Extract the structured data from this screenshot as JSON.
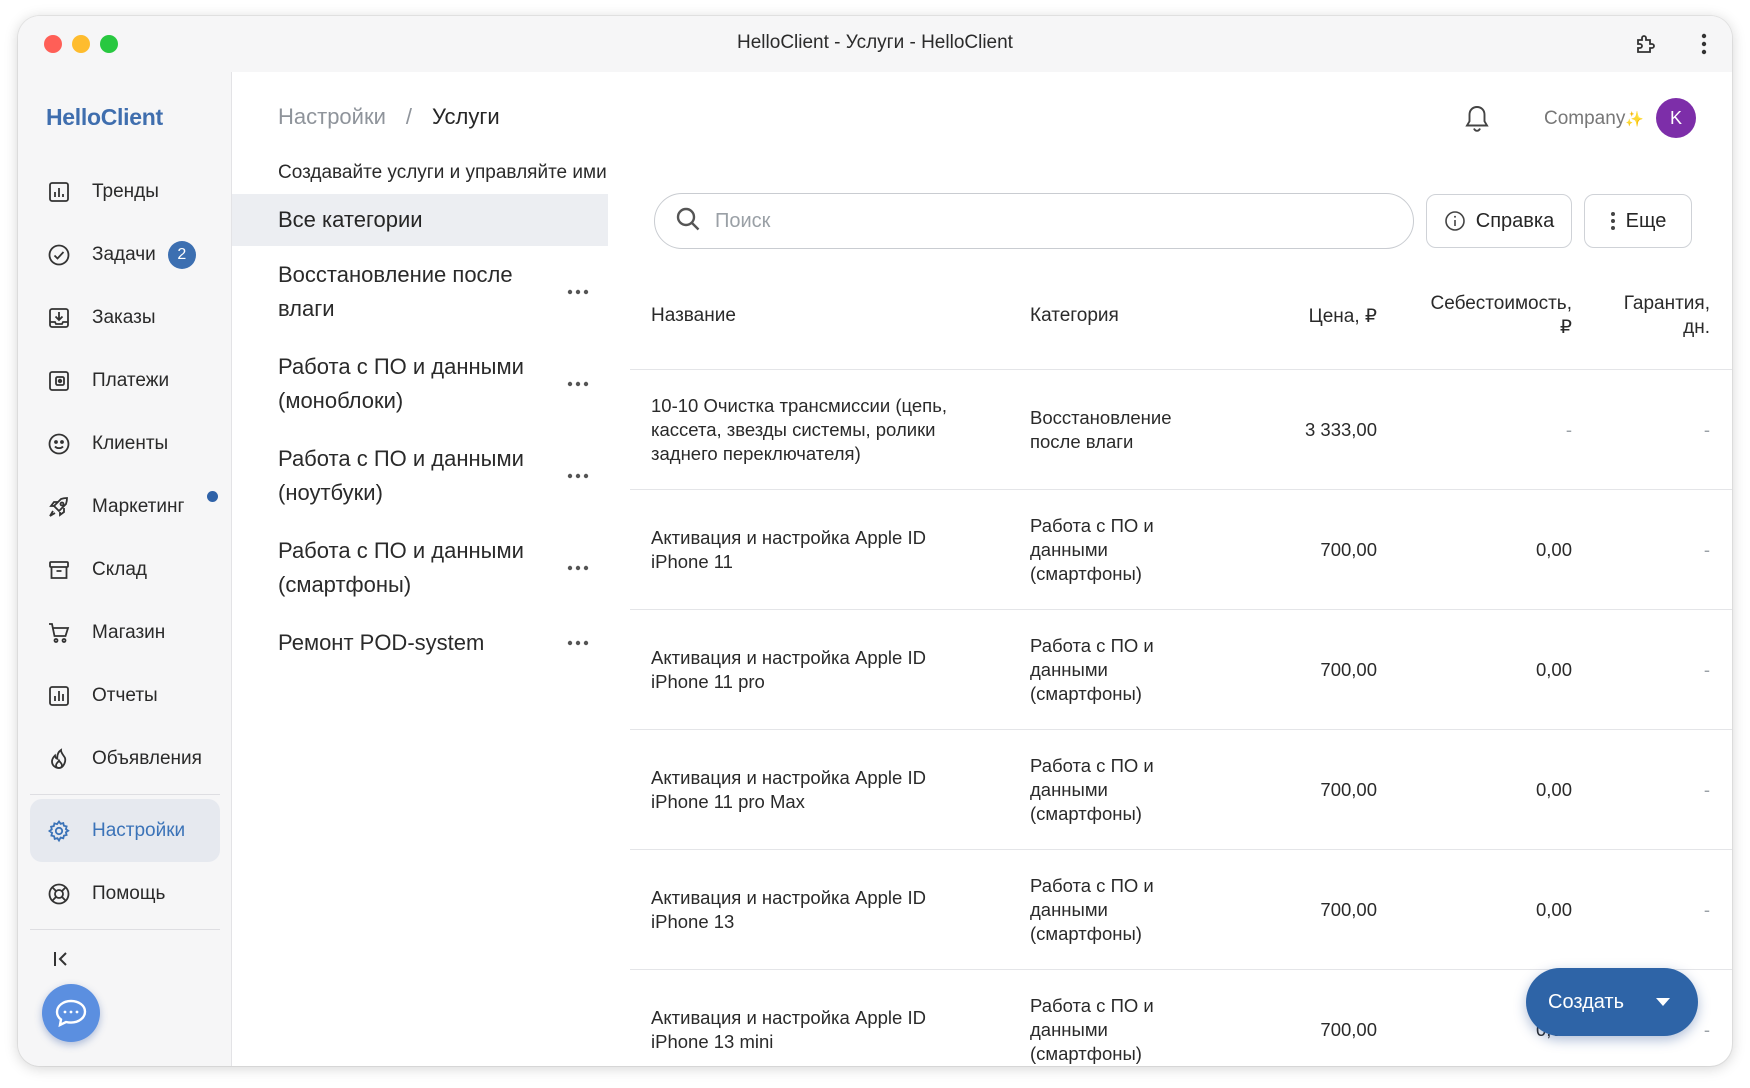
{
  "window": {
    "title": "HelloClient - Услуги - HelloClient"
  },
  "sidebar": {
    "brand": "HelloClient",
    "items": [
      {
        "label": "Тренды",
        "icon": "chart-icon"
      },
      {
        "label": "Задачи",
        "icon": "check-circle-icon",
        "badge": "2"
      },
      {
        "label": "Заказы",
        "icon": "inbox-download-icon"
      },
      {
        "label": "Платежи",
        "icon": "wallet-icon"
      },
      {
        "label": "Клиенты",
        "icon": "smile-icon"
      },
      {
        "label": "Маркетинг",
        "icon": "rocket-icon",
        "dot": true
      },
      {
        "label": "Склад",
        "icon": "archive-box-icon"
      },
      {
        "label": "Магазин",
        "icon": "cart-icon"
      },
      {
        "label": "Отчеты",
        "icon": "report-icon"
      },
      {
        "label": "Объявления",
        "icon": "flame-icon"
      },
      {
        "label": "Настройки",
        "icon": "gear-icon",
        "active": true
      },
      {
        "label": "Помощь",
        "icon": "lifebuoy-icon"
      }
    ]
  },
  "header": {
    "breadcrumb_parent": "Настройки",
    "breadcrumb_sep": "/",
    "breadcrumb_current": "Услуги",
    "company": "Company",
    "avatar_initial": "K"
  },
  "categories": {
    "subtitle": "Создавайте услуги и управляйте ими",
    "all": "Все категории",
    "items": [
      "Восстановление после влаги",
      "Работа с ПО и данными (моноблоки)",
      "Работа с ПО и данными (ноутбуки)",
      "Работа с ПО и данными (смартфоны)",
      "Ремонт POD-system"
    ]
  },
  "toolbar": {
    "search_placeholder": "Поиск",
    "help_label": "Справка",
    "more_label": "Еще"
  },
  "table": {
    "headers": {
      "name": "Название",
      "category": "Категория",
      "price": "Цена, ₽",
      "cost": "Себестоимость, ₽",
      "warranty": "Гарантия, дн."
    },
    "rows": [
      {
        "name": "10-10 Очистка трансмиссии (цепь, кассета, звезды системы, ролики заднего переключателя)",
        "category": "Восстановление после влаги",
        "price": "3 333,00",
        "cost": "-",
        "warranty": "-"
      },
      {
        "name": "Активация и настройка Apple ID iPhone 11",
        "category": "Работа с ПО и данными (смартфоны)",
        "price": "700,00",
        "cost": "0,00",
        "warranty": "-"
      },
      {
        "name": "Активация и настройка Apple ID iPhone 11 pro",
        "category": "Работа с ПО и данными (смартфоны)",
        "price": "700,00",
        "cost": "0,00",
        "warranty": "-"
      },
      {
        "name": "Активация и настройка Apple ID iPhone 11 pro Max",
        "category": "Работа с ПО и данными (смартфоны)",
        "price": "700,00",
        "cost": "0,00",
        "warranty": "-"
      },
      {
        "name": "Активация и настройка Apple ID iPhone 13",
        "category": "Работа с ПО и данными (смартфоны)",
        "price": "700,00",
        "cost": "0,00",
        "warranty": "-"
      },
      {
        "name": "Активация и настройка Apple ID iPhone 13 mini",
        "category": "Работа с ПО и данными (смартфоны)",
        "price": "700,00",
        "cost": "0,00",
        "warranty": "-"
      }
    ]
  },
  "create_button": {
    "label": "Создать"
  },
  "colors": {
    "accent": "#2e64a7",
    "brand": "#3f6eae",
    "avatar": "#7d2ea9",
    "active_bg": "#e6e9ef"
  }
}
